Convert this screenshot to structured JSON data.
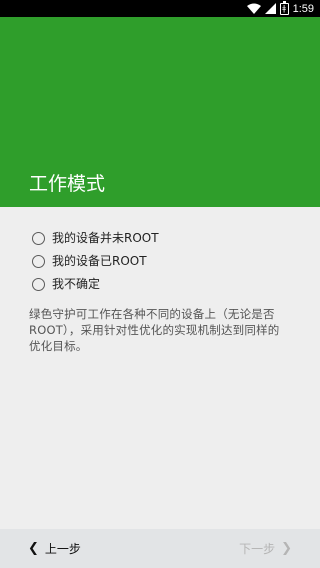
{
  "status_bar": {
    "time": "1:59",
    "battery_glyph": "ǂ",
    "icons": [
      "wifi-icon",
      "signal-icon",
      "battery-icon"
    ]
  },
  "header": {
    "title": "工作模式",
    "color": "#2f9e2b"
  },
  "options": [
    {
      "label": "我的设备并未ROOT",
      "selected": false
    },
    {
      "label": "我的设备已ROOT",
      "selected": false
    },
    {
      "label": "我不确定",
      "selected": false
    }
  ],
  "description": "绿色守护可工作在各种不同的设备上（无论是否ROOT），采用针对性优化的实现机制达到同样的优化目标。",
  "navigation": {
    "prev_label": "上一步",
    "prev_icon": "chevron-left-icon",
    "next_label": "下一步",
    "next_icon": "chevron-right-icon",
    "next_enabled": false
  }
}
